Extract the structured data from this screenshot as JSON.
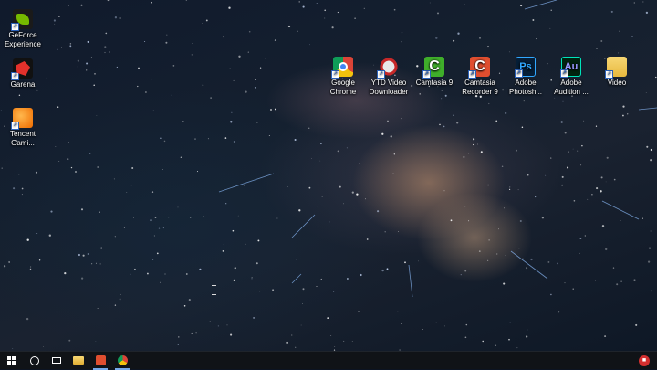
{
  "desktop": {
    "left_icons": [
      {
        "label_line1": "GeForce",
        "label_line2": "Experience",
        "icon": "geforce-icon"
      },
      {
        "label_line1": "Garena",
        "label_line2": "",
        "icon": "garena-icon"
      },
      {
        "label_line1": "Tencent",
        "label_line2": "Gami...",
        "icon": "tencent-icon"
      }
    ],
    "top_icons": [
      {
        "label_line1": "Google",
        "label_line2": "Chrome",
        "icon": "chrome-icon"
      },
      {
        "label_line1": "YTD Video",
        "label_line2": "Downloader",
        "icon": "ytd-icon"
      },
      {
        "label_line1": "Camtasia 9",
        "label_line2": "",
        "icon": "camtasia-icon",
        "glyph": "C"
      },
      {
        "label_line1": "Camtasia",
        "label_line2": "Recorder 9",
        "icon": "camtasia-recorder-icon",
        "glyph": "C"
      },
      {
        "label_line1": "Adobe",
        "label_line2": "Photosh...",
        "icon": "photoshop-icon",
        "glyph": "Ps"
      },
      {
        "label_line1": "Adobe",
        "label_line2": "Audition ...",
        "icon": "audition-icon",
        "glyph": "Au"
      },
      {
        "label_line1": "Video",
        "label_line2": "",
        "icon": "folder-icon"
      }
    ],
    "shortcut_arrow": "↗"
  },
  "taskbar": {
    "tray_badge": "■"
  }
}
